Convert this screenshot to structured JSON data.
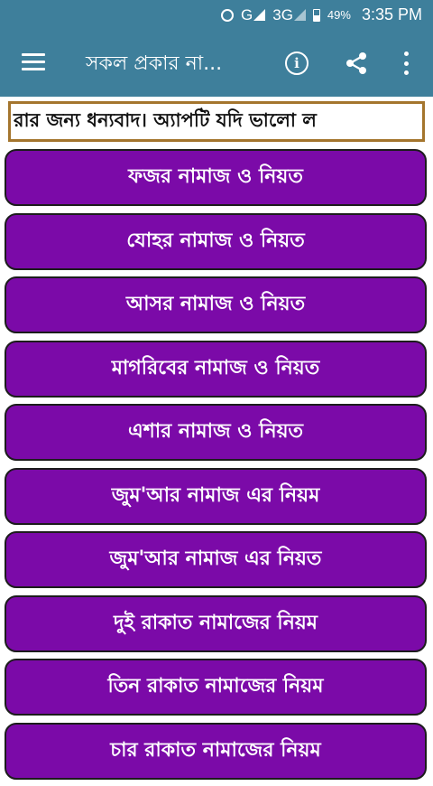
{
  "status_bar": {
    "network_g": "G",
    "network_3g": "3G",
    "battery": "49%",
    "time": "3:35 PM",
    "icons": [
      "alarm-icon",
      "signal-icon",
      "battery-icon"
    ]
  },
  "app_bar": {
    "title": "সকল প্রকার না...",
    "icons": [
      "menu-icon",
      "info-icon",
      "share-icon",
      "more-vert-icon"
    ],
    "color": "#3e7f9b"
  },
  "marquee": {
    "text": "রার জন্য ধন্যবাদ। অ্যাপটি যদি ভালো ল"
  },
  "buttons": [
    {
      "label": "ফজর নামাজ ও নিয়ত"
    },
    {
      "label": "যোহর নামাজ ও নিয়ত"
    },
    {
      "label": "আসর নামাজ ও নিয়ত"
    },
    {
      "label": "মাগরিবের নামাজ ও নিয়ত"
    },
    {
      "label": "এশার নামাজ ও নিয়ত"
    },
    {
      "label": "জুম'আর নামাজ এর নিয়ম"
    },
    {
      "label": "জুম'আর নামাজ এর নিয়ত"
    },
    {
      "label": "দুই রাকাত নামাজের নিয়ম"
    },
    {
      "label": "তিন রাকাত নামাজের নিয়ম"
    },
    {
      "label": "চার রাকাত নামাজের নিয়ম"
    }
  ],
  "colors": {
    "button_bg": "#7b0aa8",
    "marquee_border": "#a4752d"
  }
}
